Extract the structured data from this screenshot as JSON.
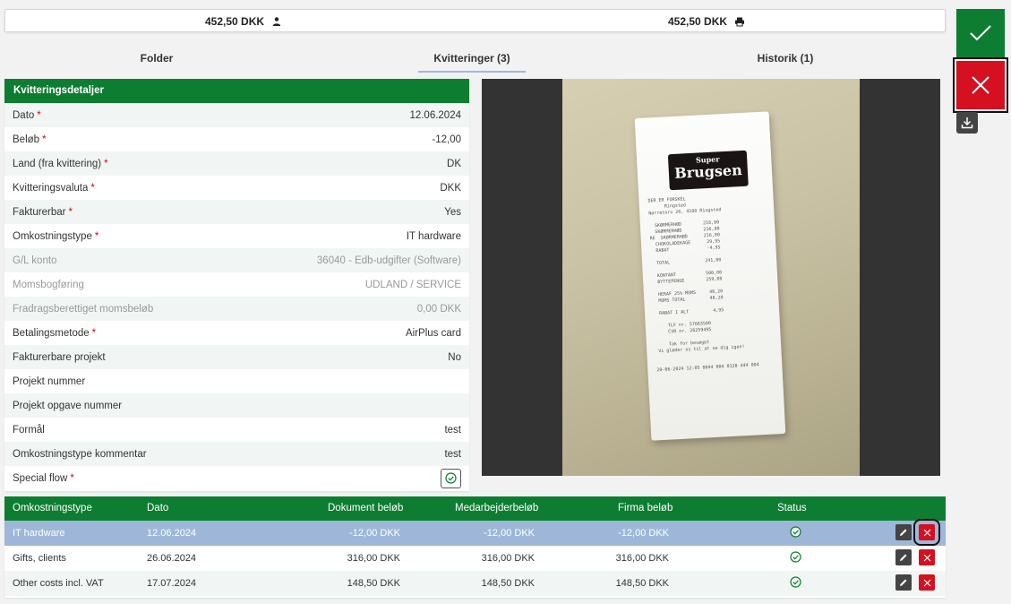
{
  "totals": {
    "employee_amount": "452,50 DKK",
    "company_amount": "452,50 DKK",
    "employee_icon": "person-icon",
    "company_icon": "printer-icon"
  },
  "tabs": [
    {
      "label": "Folder"
    },
    {
      "label": "Kvitteringer (3)",
      "active": true
    },
    {
      "label": "Historik (1)"
    }
  ],
  "details": {
    "header": "Kvitteringsdetaljer",
    "rows": [
      {
        "label": "Dato",
        "value": "12.06.2024",
        "required": "*"
      },
      {
        "label": "Beløb",
        "value": "-12,00",
        "required": "*"
      },
      {
        "label": "Land (fra kvittering)",
        "value": "DK",
        "required": "*"
      },
      {
        "label": "Kvitteringsvaluta",
        "value": "DKK",
        "required": "*"
      },
      {
        "label": "Fakturerbar",
        "value": "Yes",
        "required": "*"
      },
      {
        "label": "Omkostningstype",
        "value": "IT hardware",
        "required": "*"
      },
      {
        "label": "G/L konto",
        "value": "36040 - Edb-udgifter (Software)",
        "disabled": true
      },
      {
        "label": "Momsbogføring",
        "value": "UDLAND / SERVICE",
        "disabled": true
      },
      {
        "label": "Fradragsberettiget momsbeløb",
        "value": "0,00 DKK",
        "disabled": true
      },
      {
        "label": "Betalingsmetode",
        "value": "AirPlus card",
        "required": "*"
      },
      {
        "label": "Fakturerbare projekt",
        "value": "No"
      },
      {
        "label": "Projekt nummer",
        "value": ""
      },
      {
        "label": "Projekt opgave nummer",
        "value": ""
      },
      {
        "label": "Formål",
        "value": "test"
      },
      {
        "label": "Omkostningstype kommentar",
        "value": "test"
      },
      {
        "label": "Special flow",
        "required": "*",
        "checked": true
      }
    ]
  },
  "receipt_image": {
    "store_top": "Super",
    "store_name": "Brugsen",
    "lines": "DER ER FORSKEL\n      Ringsted\nNørretorv 26, 4100 Ringsted\n\n  SKØRMERHØD        216,00\n  SKØRMERHØD        216,00\nRE  SKØRMERHØD      216,00\n  CHOKOLADEKAGE      29,95\n  RABAT              -4,95\n\n  TOTAL             241,00\n\n  KONTANT           500,00\n  BYTTEPENGE        259,00\n\n  HERAF 25% MOMS     48,20\n  MOMS TOTAL         48,20\n\n  RABAT I ALT         4,95\n\n     TLF nr. 57663500\n     CVR nr. 26259495\n\n     Tak for besøget\n Vi glæder os til at se dig igen!\n\n\n20-06-2024 12:05 0044 004 0128 444 004"
  },
  "actions": {
    "approve_icon": "check-icon",
    "reject_icon": "close-icon",
    "download_icon": "download-icon"
  },
  "table": {
    "headers": {
      "type": "Omkostningstype",
      "date": "Dato",
      "doc": "Dokument beløb",
      "emp": "Medarbejderbeløb",
      "firm": "Firma beløb",
      "status": "Status"
    },
    "rows": [
      {
        "type": "IT hardware",
        "date": "12.06.2024",
        "doc": "-12,00 DKK",
        "emp": "-12,00 DKK",
        "firm": "-12,00 DKK",
        "status": "ok",
        "selected": true
      },
      {
        "type": "Gifts, clients",
        "date": "26.06.2024",
        "doc": "316,00 DKK",
        "emp": "316,00 DKK",
        "firm": "316,00 DKK",
        "status": "ok"
      },
      {
        "type": "Other costs incl. VAT",
        "date": "17.07.2024",
        "doc": "148,50 DKK",
        "emp": "148,50 DKK",
        "firm": "148,50 DKK",
        "status": "ok"
      }
    ]
  },
  "colors": {
    "brand_green": "#0d7d32",
    "danger_red": "#d41021",
    "selected_row": "#9eb7d9",
    "status_green": "#0d7d32"
  }
}
